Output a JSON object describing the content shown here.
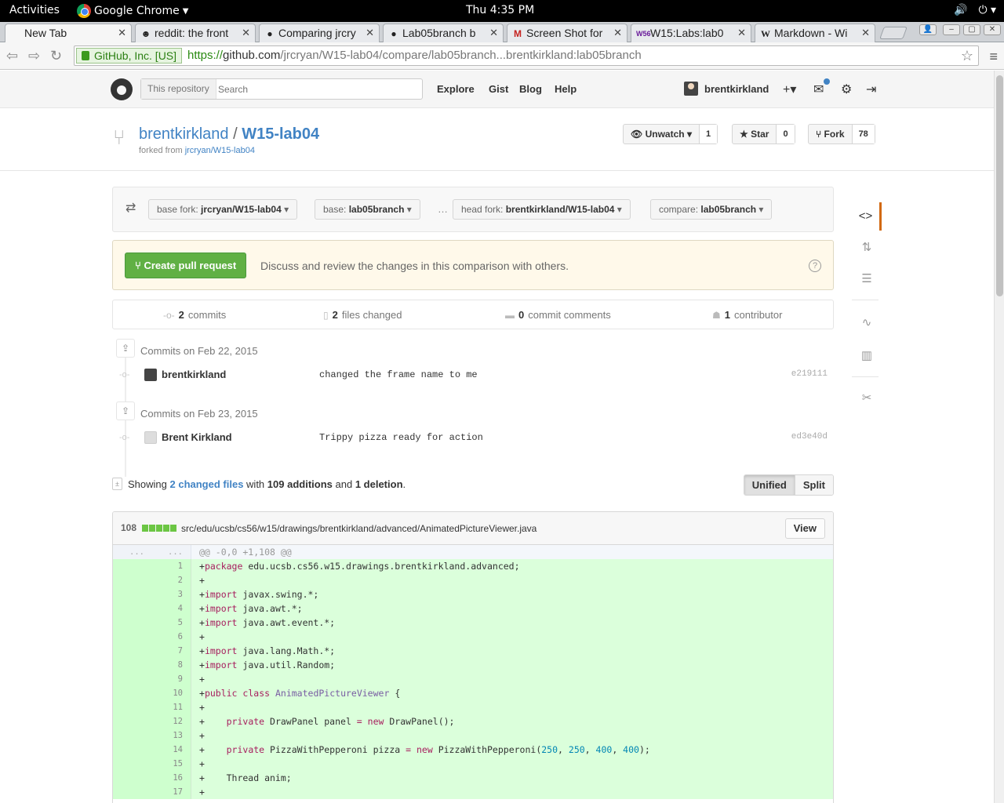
{
  "topbar": {
    "activities": "Activities",
    "app": "Google Chrome",
    "clock": "Thu  4:35 PM"
  },
  "tabs": [
    {
      "title": "New Tab",
      "icon": "none"
    },
    {
      "title": "reddit: the front",
      "icon": "reddit-icon"
    },
    {
      "title": "Comparing jrcry",
      "icon": "github-icon"
    },
    {
      "title": "Lab05branch b",
      "icon": "github-icon"
    },
    {
      "title": "Screen Shot for",
      "icon": "gmail-icon"
    },
    {
      "title": "W15:Labs:lab0",
      "icon": "w56-icon"
    },
    {
      "title": "Markdown - Wi",
      "icon": "wikipedia-icon"
    }
  ],
  "omnibox": {
    "ev_label": "GitHub, Inc. [US]",
    "scheme": "https://",
    "host": "github.com",
    "path": "/jrcryan/W15-lab04/compare/lab05branch...brentkirkland:lab05branch"
  },
  "header": {
    "search_scope": "This repository",
    "search_placeholder": "Search",
    "nav": [
      "Explore",
      "Gist",
      "Blog",
      "Help"
    ],
    "username": "brentkirkland"
  },
  "repo": {
    "owner": "brentkirkland",
    "separator": "/",
    "name": "W15-lab04",
    "forked_prefix": "forked from",
    "forked_from": "jrcryan/W15-lab04",
    "unwatch_label": "Unwatch",
    "watch_count": "1",
    "star_label": "Star",
    "star_count": "0",
    "fork_label": "Fork",
    "fork_count": "78"
  },
  "compare": {
    "base_fork_label": "base fork:",
    "base_fork": "jrcryan/W15-lab04",
    "base_label": "base:",
    "base": "lab05branch",
    "dots": "…",
    "head_fork_label": "head fork:",
    "head_fork": "brentkirkland/W15-lab04",
    "compare_label": "compare:",
    "compare": "lab05branch"
  },
  "pr": {
    "button": "Create pull request",
    "text": "Discuss and review the changes in this comparison with others.",
    "help": "?"
  },
  "summary": {
    "commits_n": "2",
    "commits_label": "commits",
    "files_n": "2",
    "files_label": "files changed",
    "comments_n": "0",
    "comments_label": "commit comments",
    "contrib_n": "1",
    "contrib_label": "contributor"
  },
  "commit_groups": [
    {
      "date": "Commits on Feb 22, 2015",
      "commits": [
        {
          "author": "brentkirkland",
          "message": "changed the frame name to me",
          "sha": "e219111"
        }
      ]
    },
    {
      "date": "Commits on Feb 23, 2015",
      "commits": [
        {
          "author": "Brent Kirkland",
          "message": "Trippy pizza ready for action",
          "sha": "ed3e40d"
        }
      ]
    }
  ],
  "toc": {
    "showing": "Showing",
    "changed_files": "2 changed files",
    "with": "with",
    "additions": "109 additions",
    "and": "and",
    "deletions": "1 deletion",
    "period": ".",
    "unified": "Unified",
    "split": "Split"
  },
  "file": {
    "count": "108",
    "path": "src/edu/ucsb/cs56/w15/drawings/brentkirkland/advanced/AnimatedPictureViewer.java",
    "view": "View",
    "hunk_old": "...",
    "hunk_new": "...",
    "hunk": "@@ -0,0 +1,108 @@",
    "lines": [
      {
        "n": "1",
        "code": "+package edu.ucsb.cs56.w15.drawings.brentkirkland.advanced;"
      },
      {
        "n": "2",
        "code": "+"
      },
      {
        "n": "3",
        "code": "+import javax.swing.*;"
      },
      {
        "n": "4",
        "code": "+import java.awt.*;"
      },
      {
        "n": "5",
        "code": "+import java.awt.event.*;"
      },
      {
        "n": "6",
        "code": "+"
      },
      {
        "n": "7",
        "code": "+import java.lang.Math.*;"
      },
      {
        "n": "8",
        "code": "+import java.util.Random;"
      },
      {
        "n": "9",
        "code": "+"
      },
      {
        "n": "10",
        "code": "+public class AnimatedPictureViewer {"
      },
      {
        "n": "11",
        "code": "+"
      },
      {
        "n": "12",
        "code": "+    private DrawPanel panel = new DrawPanel();"
      },
      {
        "n": "13",
        "code": "+"
      },
      {
        "n": "14",
        "code": "+    private PizzaWithPepperoni pizza = new PizzaWithPepperoni(250, 250, 400, 400);"
      },
      {
        "n": "15",
        "code": "+"
      },
      {
        "n": "16",
        "code": "+    Thread anim;"
      },
      {
        "n": "17",
        "code": "+"
      }
    ]
  },
  "colors": {
    "accent": "#4183c4",
    "pr_green": "#60b044",
    "addition_bg": "#dbffdb",
    "selected_nav": "#d26911"
  }
}
